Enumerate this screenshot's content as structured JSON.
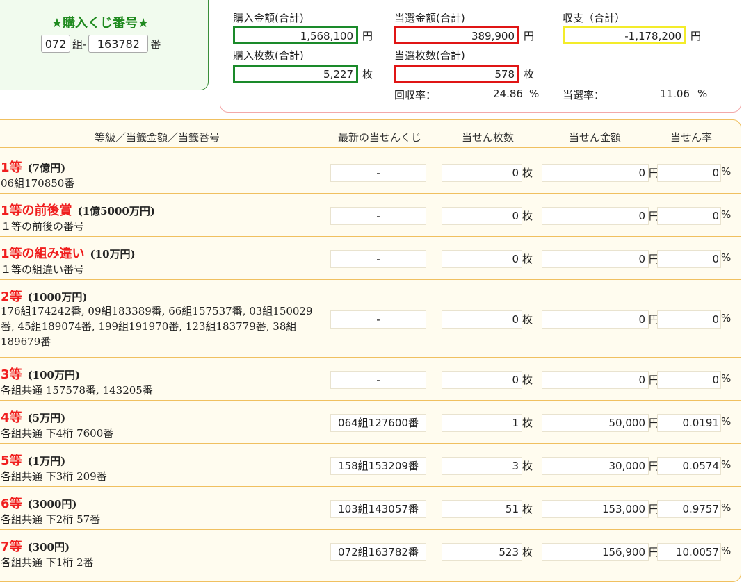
{
  "ticket": {
    "title": "★購入くじ番号★",
    "group": "072",
    "group_suffix": "組-",
    "number": "163782",
    "number_suffix": "番"
  },
  "summary": {
    "purchase_amount_label": "購入金額(合計)",
    "purchase_amount": "1,568,100",
    "win_amount_label": "当選金額(合計)",
    "win_amount": "389,900",
    "balance_label": "収支（合計）",
    "balance": "-1,178,200",
    "yen": "円",
    "purchase_count_label": "購入枚数(合計)",
    "purchase_count": "5,227",
    "win_count_label": "当選枚数(合計)",
    "win_count": "578",
    "sheet": "枚",
    "return_rate_label": "回収率：",
    "return_rate": "24.86",
    "win_rate_label": "当選率：",
    "win_rate": "11.06",
    "percent": "%"
  },
  "table": {
    "headers": {
      "grade": "等級／当籤金額／当籤番号",
      "latest": "最新の当せんくじ",
      "count": "当せん枚数",
      "amount": "当せん金額",
      "rate": "当せん率"
    },
    "units": {
      "sheet": "枚",
      "yen": "円",
      "percent": "%"
    },
    "rows": [
      {
        "grade": "1等",
        "prize": "(7億円)",
        "desc": "06組170850番",
        "latest": "-",
        "count": "0",
        "amount": "0",
        "rate": "0"
      },
      {
        "grade": "1等の前後賞",
        "prize": "(1億5000万円)",
        "desc": "１等の前後の番号",
        "latest": "-",
        "count": "0",
        "amount": "0",
        "rate": "0"
      },
      {
        "grade": "1等の組み違い",
        "prize": "(10万円)",
        "desc": "１等の組違い番号",
        "latest": "-",
        "count": "0",
        "amount": "0",
        "rate": "0"
      },
      {
        "grade": "2等",
        "prize": "(1000万円)",
        "desc": "176組174242番, 09組183389番, 66組157537番, 03組150029番, 45組189074番, 199組191970番, 123組183779番, 38組189679番",
        "latest": "-",
        "count": "0",
        "amount": "0",
        "rate": "0"
      },
      {
        "grade": "3等",
        "prize": "(100万円)",
        "desc": "各組共通 157578番, 143205番",
        "latest": "-",
        "count": "0",
        "amount": "0",
        "rate": "0"
      },
      {
        "grade": "4等",
        "prize": "(5万円)",
        "desc": "各組共通 下4桁 7600番",
        "latest": "064組127600番",
        "count": "1",
        "amount": "50,000",
        "rate": "0.0191"
      },
      {
        "grade": "5等",
        "prize": "(1万円)",
        "desc": "各組共通 下3桁 209番",
        "latest": "158組153209番",
        "count": "3",
        "amount": "30,000",
        "rate": "0.0574"
      },
      {
        "grade": "6等",
        "prize": "(3000円)",
        "desc": "各組共通 下2桁 57番",
        "latest": "103組143057番",
        "count": "51",
        "amount": "153,000",
        "rate": "0.9757"
      },
      {
        "grade": "7等",
        "prize": "(300円)",
        "desc": "各組共通 下1桁 2番",
        "latest": "072組163782番",
        "count": "523",
        "amount": "156,900",
        "rate": "10.0057"
      }
    ]
  },
  "colors": {
    "green": "#1a8a2a",
    "red": "#e01515",
    "yellow": "#f3ec2a",
    "grade_red": "#f01e1e",
    "panel_border": "#f0c060"
  }
}
